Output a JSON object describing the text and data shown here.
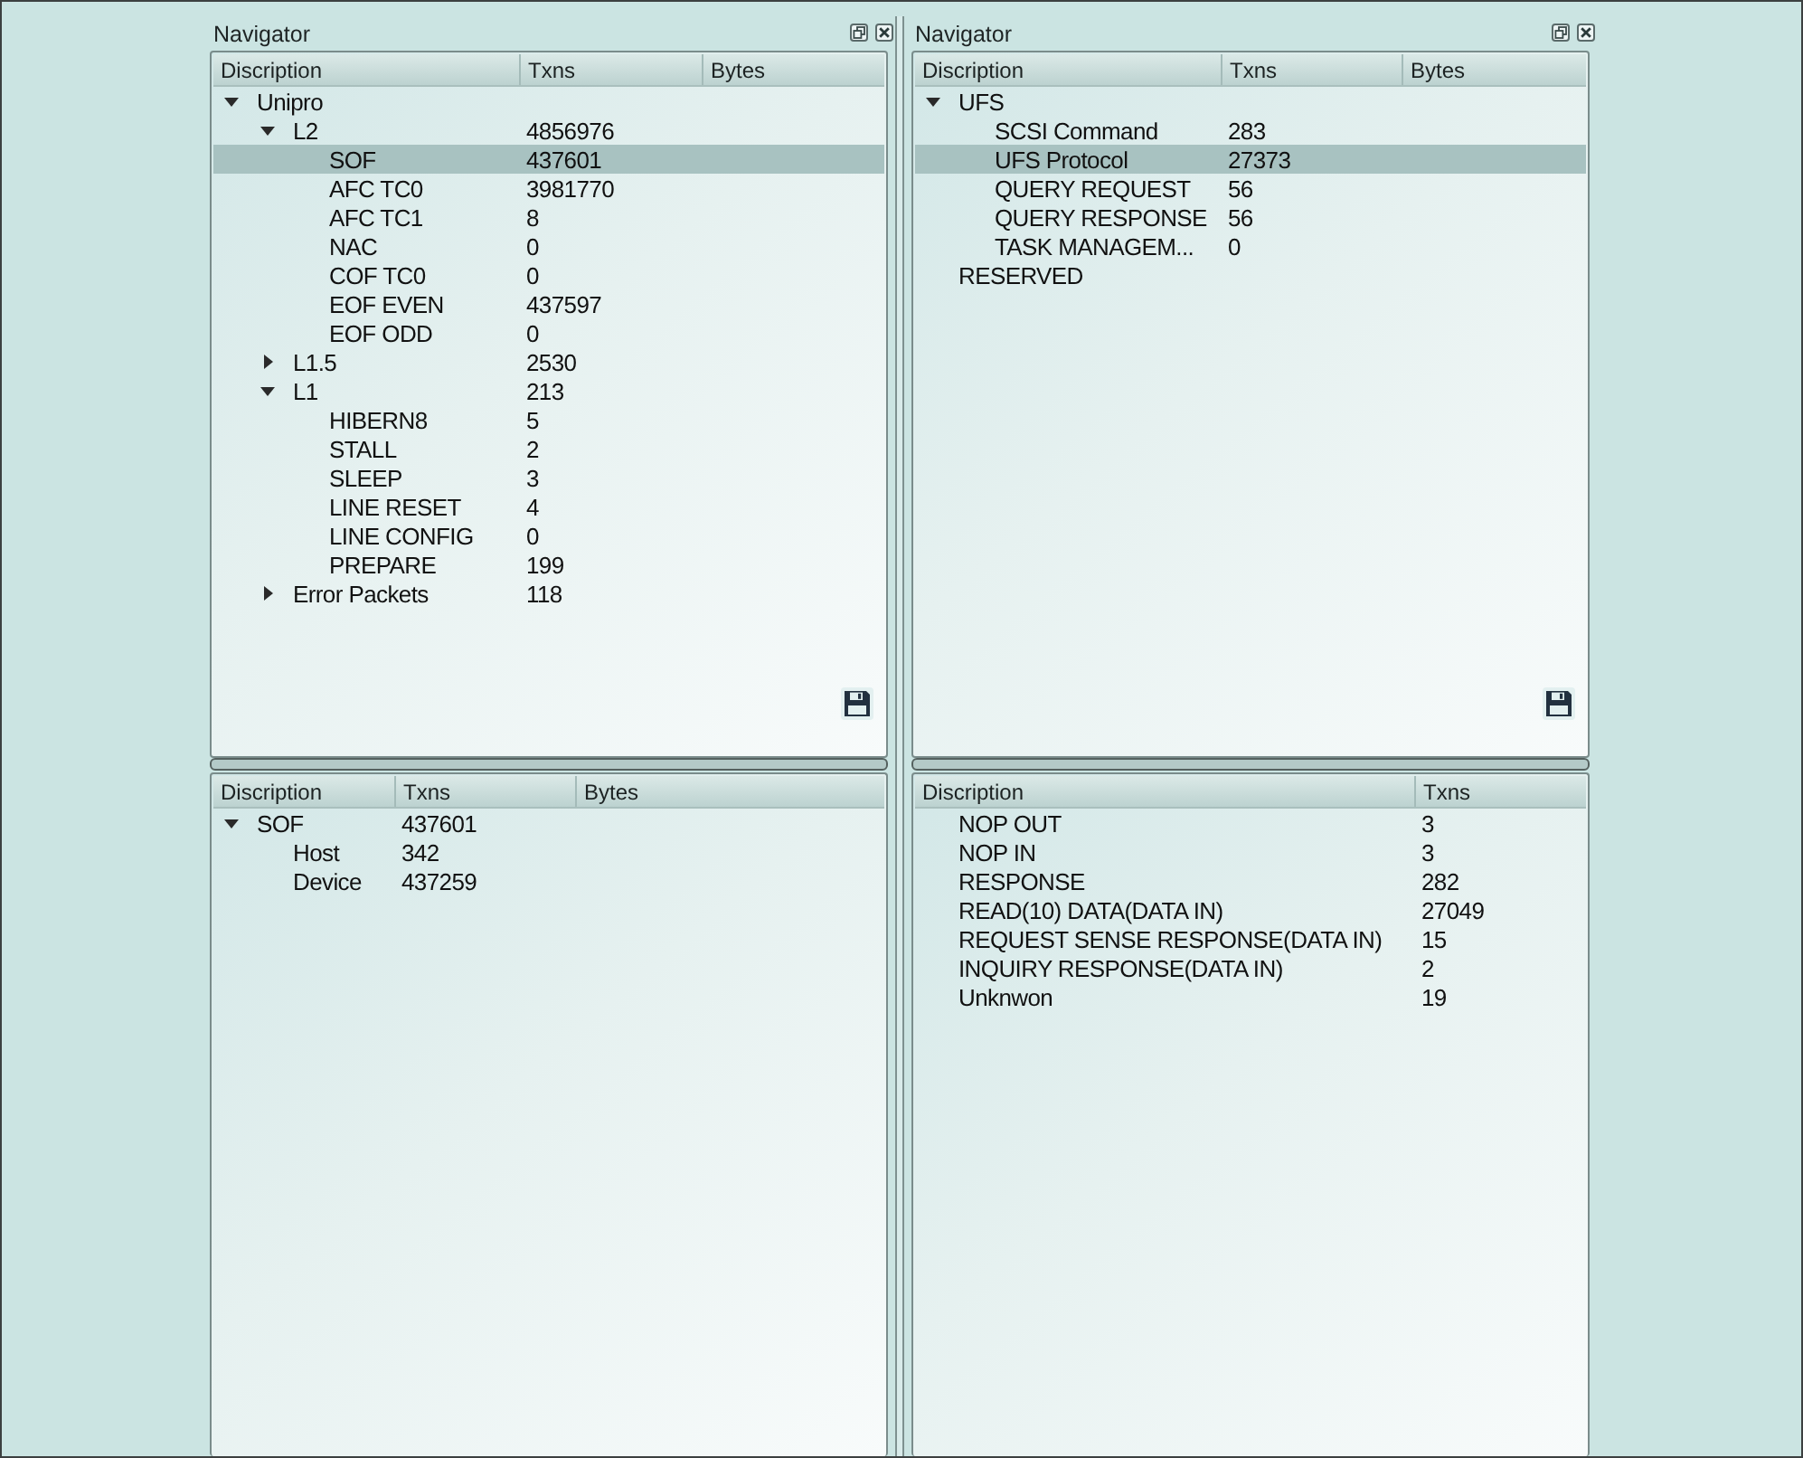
{
  "panels": [
    {
      "title": "Navigator",
      "tree": {
        "columns": [
          "Discription",
          "Txns",
          "Bytes"
        ],
        "rows": [
          {
            "label": "Unipro",
            "expanded": true,
            "selected": false,
            "children": [
              {
                "label": "L2",
                "txns": "4856976",
                "expanded": true,
                "selected": false,
                "children": [
                  {
                    "label": "SOF",
                    "txns": "437601",
                    "selected": true
                  },
                  {
                    "label": "AFC TC0",
                    "txns": "3981770",
                    "selected": false
                  },
                  {
                    "label": "AFC TC1",
                    "txns": "8",
                    "selected": false
                  },
                  {
                    "label": "NAC",
                    "txns": "0",
                    "selected": false
                  },
                  {
                    "label": "COF TC0",
                    "txns": "0",
                    "selected": false
                  },
                  {
                    "label": "EOF EVEN",
                    "txns": "437597",
                    "selected": false
                  },
                  {
                    "label": "EOF ODD",
                    "txns": "0",
                    "selected": false
                  }
                ]
              },
              {
                "label": "L1.5",
                "txns": "2530",
                "expanded": false,
                "selected": false
              },
              {
                "label": "L1",
                "txns": "213",
                "expanded": true,
                "selected": false,
                "children": [
                  {
                    "label": "HIBERN8",
                    "txns": "5",
                    "selected": false
                  },
                  {
                    "label": "STALL",
                    "txns": "2",
                    "selected": false
                  },
                  {
                    "label": "SLEEP",
                    "txns": "3",
                    "selected": false
                  },
                  {
                    "label": "LINE RESET",
                    "txns": "4",
                    "selected": false
                  },
                  {
                    "label": "LINE CONFIG",
                    "txns": "0",
                    "selected": false
                  },
                  {
                    "label": "PREPARE",
                    "txns": "199",
                    "selected": false
                  }
                ]
              },
              {
                "label": "Error Packets",
                "txns": "118",
                "expanded": false,
                "selected": false
              }
            ]
          }
        ]
      },
      "detail": {
        "columns": [
          "Discription",
          "Txns",
          "Bytes"
        ],
        "rows": [
          {
            "label": "SOF",
            "txns": "437601",
            "expanded": true,
            "selected": false,
            "children": [
              {
                "label": "Host",
                "txns": "342",
                "selected": false
              },
              {
                "label": "Device",
                "txns": "437259",
                "selected": false
              }
            ]
          }
        ]
      }
    },
    {
      "title": "Navigator",
      "tree": {
        "columns": [
          "Discription",
          "Txns",
          "Bytes"
        ],
        "rows": [
          {
            "label": "UFS",
            "expanded": true,
            "selected": false,
            "children": [
              {
                "label": "SCSI Command",
                "txns": "283",
                "selected": false
              },
              {
                "label": "UFS Protocol",
                "txns": "27373",
                "selected": true
              },
              {
                "label": "QUERY REQUEST",
                "txns": "56",
                "selected": false
              },
              {
                "label": "QUERY RESPONSE",
                "txns": "56",
                "selected": false
              },
              {
                "label": "TASK MANAGEM...",
                "txns": "0",
                "selected": false
              }
            ]
          },
          {
            "label": "RESERVED",
            "selected": false
          }
        ]
      },
      "detail": {
        "columns": [
          "Discription",
          "Txns"
        ],
        "rows": [
          {
            "label": "NOP OUT",
            "txns": "3",
            "selected": false
          },
          {
            "label": "NOP IN",
            "txns": "3",
            "selected": false
          },
          {
            "label": "RESPONSE",
            "txns": "282",
            "selected": false
          },
          {
            "label": "READ(10) DATA(DATA IN)",
            "txns": "27049",
            "selected": false
          },
          {
            "label": "REQUEST SENSE RESPONSE(DATA IN)",
            "txns": "15",
            "selected": false
          },
          {
            "label": "INQUIRY RESPONSE(DATA IN)",
            "txns": "2",
            "selected": false
          },
          {
            "label": "Unknwon",
            "txns": "19",
            "selected": false
          }
        ]
      }
    }
  ]
}
